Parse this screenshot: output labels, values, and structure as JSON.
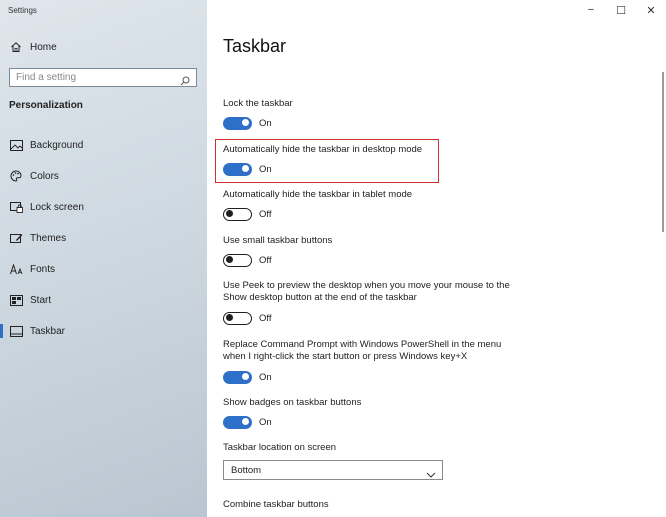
{
  "window": {
    "app_title": "Settings",
    "controls": {
      "minimize": "−",
      "maximize": "☐",
      "close": "✕"
    }
  },
  "sidebar": {
    "home": {
      "label": "Home",
      "icon": "home-icon"
    },
    "search": {
      "placeholder": "Find a setting",
      "value": "",
      "icon": "search-icon"
    },
    "section": "Personalization",
    "items": [
      {
        "label": "Background",
        "icon": "background-icon",
        "selected": false
      },
      {
        "label": "Colors",
        "icon": "palette-icon",
        "selected": false
      },
      {
        "label": "Lock screen",
        "icon": "lock-screen-icon",
        "selected": false
      },
      {
        "label": "Themes",
        "icon": "themes-icon",
        "selected": false
      },
      {
        "label": "Fonts",
        "icon": "fonts-icon",
        "selected": false
      },
      {
        "label": "Start",
        "icon": "start-icon",
        "selected": false
      },
      {
        "label": "Taskbar",
        "icon": "taskbar-icon",
        "selected": true
      }
    ]
  },
  "main": {
    "title": "Taskbar",
    "settings": [
      {
        "label": "Lock the taskbar",
        "state": "On",
        "on": true
      },
      {
        "label": "Automatically hide the taskbar in desktop mode",
        "state": "On",
        "on": true
      },
      {
        "label": "Automatically hide the taskbar in tablet mode",
        "state": "Off",
        "on": false
      },
      {
        "label": "Use small taskbar buttons",
        "state": "Off",
        "on": false
      },
      {
        "label": "Use Peek to preview the desktop when you move your mouse to the Show desktop button at the end of the taskbar",
        "state": "Off",
        "on": false
      },
      {
        "label": "Replace Command Prompt with Windows PowerShell in the menu when I right-click the start button or press Windows key+X",
        "state": "On",
        "on": true
      },
      {
        "label": "Show badges on taskbar buttons",
        "state": "On",
        "on": true
      }
    ],
    "location": {
      "label": "Taskbar location on screen",
      "value": "Bottom"
    },
    "combine": {
      "label": "Combine taskbar buttons"
    }
  },
  "colors": {
    "accent": "#2e6fc9",
    "highlight": "#d32f2f"
  }
}
